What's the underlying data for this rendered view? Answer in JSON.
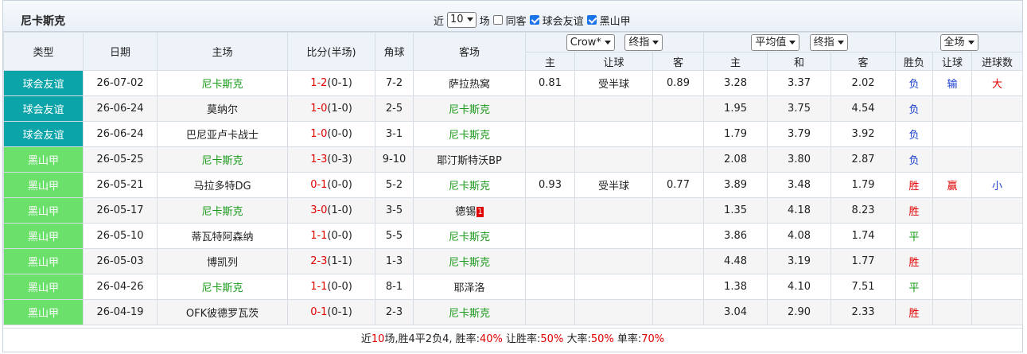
{
  "title": "尼卡斯克",
  "filters": {
    "near_label": "近",
    "count": "10",
    "unit_label": "场",
    "same_home_label": "同客",
    "same_home_checked": false,
    "league1_label": "球会友谊",
    "league1_checked": true,
    "league2_label": "黑山甲",
    "league2_checked": true
  },
  "header": {
    "type": "类型",
    "date": "日期",
    "home": "主场",
    "score": "比分(半场)",
    "corner": "角球",
    "away": "客场",
    "company_select": "Crow*",
    "handicap_select": "终指",
    "odds_select": "平均值",
    "odds_select2": "终指",
    "result_select": "全场",
    "sub_home": "主",
    "sub_handicap": "让球",
    "sub_away": "客",
    "sub_odds_home": "主",
    "sub_odds_draw": "和",
    "sub_odds_away": "客",
    "sub_wl": "胜负",
    "sub_hc": "让球",
    "sub_ou": "进球数"
  },
  "matches": [
    {
      "type": "球会友谊",
      "league": 1,
      "date": "26-07-02",
      "home": "尼卡斯克",
      "home_is_team": true,
      "score_full": "1-2",
      "score_half": "(0-1)",
      "corner": "7-2",
      "away": "萨拉热窝",
      "away_is_team": false,
      "red_card": "",
      "h_home": "0.81",
      "h_line": "受半球",
      "h_away": "0.89",
      "o_home": "3.28",
      "o_draw": "3.37",
      "o_away": "2.02",
      "wl": "负",
      "wl_color": "blue",
      "hc": "输",
      "hc_color": "blue",
      "ou": "大",
      "ou_color": "red"
    },
    {
      "type": "球会友谊",
      "league": 1,
      "date": "26-06-24",
      "home": "莫纳尔",
      "home_is_team": false,
      "score_full": "1-0",
      "score_half": "(1-0)",
      "corner": "2-5",
      "away": "尼卡斯克",
      "away_is_team": true,
      "red_card": "",
      "h_home": "",
      "h_line": "",
      "h_away": "",
      "o_home": "1.95",
      "o_draw": "3.75",
      "o_away": "4.54",
      "wl": "负",
      "wl_color": "blue",
      "hc": "",
      "hc_color": "",
      "ou": "",
      "ou_color": ""
    },
    {
      "type": "球会友谊",
      "league": 1,
      "date": "26-06-24",
      "home": "巴尼亚卢卡战士",
      "home_is_team": false,
      "score_full": "1-0",
      "score_half": "(0-0)",
      "corner": "3-1",
      "away": "尼卡斯克",
      "away_is_team": true,
      "red_card": "",
      "h_home": "",
      "h_line": "",
      "h_away": "",
      "o_home": "1.79",
      "o_draw": "3.79",
      "o_away": "3.92",
      "wl": "负",
      "wl_color": "blue",
      "hc": "",
      "hc_color": "",
      "ou": "",
      "ou_color": ""
    },
    {
      "type": "黑山甲",
      "league": 2,
      "date": "26-05-25",
      "home": "尼卡斯克",
      "home_is_team": true,
      "score_full": "1-3",
      "score_half": "(0-3)",
      "corner": "9-10",
      "away": "耶汀斯特沃BP",
      "away_is_team": false,
      "red_card": "",
      "h_home": "",
      "h_line": "",
      "h_away": "",
      "o_home": "2.08",
      "o_draw": "3.80",
      "o_away": "2.87",
      "wl": "负",
      "wl_color": "blue",
      "hc": "",
      "hc_color": "",
      "ou": "",
      "ou_color": ""
    },
    {
      "type": "黑山甲",
      "league": 2,
      "date": "26-05-21",
      "home": "马拉多特DG",
      "home_is_team": false,
      "score_full": "0-1",
      "score_half": "(0-0)",
      "corner": "5-2",
      "away": "尼卡斯克",
      "away_is_team": true,
      "red_card": "",
      "h_home": "0.93",
      "h_line": "受半球",
      "h_away": "0.77",
      "o_home": "3.89",
      "o_draw": "3.48",
      "o_away": "1.79",
      "wl": "胜",
      "wl_color": "red",
      "hc": "赢",
      "hc_color": "red",
      "ou": "小",
      "ou_color": "blue"
    },
    {
      "type": "黑山甲",
      "league": 2,
      "date": "26-05-17",
      "home": "尼卡斯克",
      "home_is_team": true,
      "score_full": "3-0",
      "score_half": "(1-0)",
      "corner": "3-5",
      "away": "德锡",
      "away_is_team": false,
      "red_card": "1",
      "h_home": "",
      "h_line": "",
      "h_away": "",
      "o_home": "1.35",
      "o_draw": "4.18",
      "o_away": "8.23",
      "wl": "胜",
      "wl_color": "red",
      "hc": "",
      "hc_color": "",
      "ou": "",
      "ou_color": ""
    },
    {
      "type": "黑山甲",
      "league": 2,
      "date": "26-05-10",
      "home": "蒂瓦特阿森纳",
      "home_is_team": false,
      "score_full": "1-1",
      "score_half": "(0-0)",
      "corner": "5-5",
      "away": "尼卡斯克",
      "away_is_team": true,
      "red_card": "",
      "h_home": "",
      "h_line": "",
      "h_away": "",
      "o_home": "3.86",
      "o_draw": "4.08",
      "o_away": "1.74",
      "wl": "平",
      "wl_color": "green",
      "hc": "",
      "hc_color": "",
      "ou": "",
      "ou_color": ""
    },
    {
      "type": "黑山甲",
      "league": 2,
      "date": "26-05-03",
      "home": "博凯列",
      "home_is_team": false,
      "score_full": "2-3",
      "score_half": "(1-1)",
      "corner": "1-3",
      "away": "尼卡斯克",
      "away_is_team": true,
      "red_card": "",
      "h_home": "",
      "h_line": "",
      "h_away": "",
      "o_home": "4.48",
      "o_draw": "3.19",
      "o_away": "1.77",
      "wl": "胜",
      "wl_color": "red",
      "hc": "",
      "hc_color": "",
      "ou": "",
      "ou_color": ""
    },
    {
      "type": "黑山甲",
      "league": 2,
      "date": "26-04-26",
      "home": "尼卡斯克",
      "home_is_team": true,
      "score_full": "1-1",
      "score_half": "(0-0)",
      "corner": "8-1",
      "away": "耶泽洛",
      "away_is_team": false,
      "red_card": "",
      "h_home": "",
      "h_line": "",
      "h_away": "",
      "o_home": "1.38",
      "o_draw": "4.10",
      "o_away": "7.51",
      "wl": "平",
      "wl_color": "green",
      "hc": "",
      "hc_color": "",
      "ou": "",
      "ou_color": ""
    },
    {
      "type": "黑山甲",
      "league": 2,
      "date": "26-04-19",
      "home": "OFK彼德罗瓦茨",
      "home_is_team": false,
      "score_full": "0-1",
      "score_half": "(0-1)",
      "corner": "2-3",
      "away": "尼卡斯克",
      "away_is_team": true,
      "red_card": "",
      "h_home": "",
      "h_line": "",
      "h_away": "",
      "o_home": "3.04",
      "o_draw": "2.90",
      "o_away": "2.33",
      "wl": "胜",
      "wl_color": "red",
      "hc": "",
      "hc_color": "",
      "ou": "",
      "ou_color": ""
    }
  ],
  "summary": {
    "prefix": "近",
    "count": "10",
    "mid": "场,胜4平2负4, 胜率:",
    "win_rate": "40%",
    "hc_label": " 让胜率:",
    "hc_rate": "50%",
    "big_label": " 大率:",
    "big_rate": "50%",
    "odd_label": " 单率:",
    "odd_rate": "70%"
  }
}
